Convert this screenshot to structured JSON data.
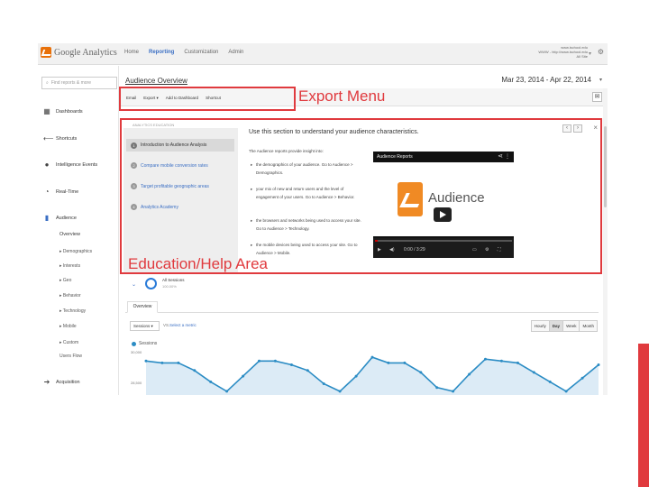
{
  "app": {
    "logo_text": "Google Analytics",
    "top_nav": [
      "Home",
      "Reporting",
      "Customization",
      "Admin"
    ],
    "active_nav": "Reporting",
    "account_line1": "www.ischool.edu",
    "account_line2": "WWW - http://www.ischool.edu",
    "account_line3": "All Site"
  },
  "sidebar": {
    "search_placeholder": "Find reports & more",
    "items": [
      {
        "label": "Dashboards",
        "icon": "grid-icon"
      },
      {
        "label": "Shortcuts",
        "icon": "arrow-left-icon"
      },
      {
        "label": "Intelligence Events",
        "icon": "lightbulb-icon"
      },
      {
        "label": "Real-Time",
        "icon": "clock-icon"
      },
      {
        "label": "Audience",
        "icon": "person-icon"
      },
      {
        "label": "Acquisition",
        "icon": "acquisition-icon"
      }
    ],
    "audience_sub": [
      "Overview",
      "▸ Demographics",
      "▸ Interests",
      "▸ Geo",
      "▸ Behavior",
      "▸ Technology",
      "▸ Mobile",
      "▸ Custom",
      "Users Flow"
    ]
  },
  "header": {
    "page_title": "Audience Overview",
    "date_range": "Mar 23, 2014 - Apr 22, 2014"
  },
  "export_menu": {
    "items": [
      "Email",
      "Export ▾",
      "Add to Dashboard",
      "Shortcut"
    ]
  },
  "help": {
    "section_label": "ANALYTICS EDUCATION",
    "title": "Use this section to understand your audience characteristics.",
    "links": [
      {
        "num": "1",
        "label": "Introduction to Audience Analysis"
      },
      {
        "num": "2",
        "label": "Compare mobile conversion rates"
      },
      {
        "num": "3",
        "label": "Target profitable geographic areas"
      },
      {
        "num": "4",
        "label": "Analytics Academy"
      }
    ],
    "intro": "The Audience reports provide insight into:",
    "bullets": [
      "the demographics of your audience. Go to Audience > Demographics.",
      "your mix of new and return users and the level of engagement of your users. Go to Audience > Behavior.",
      "the browsers and networks being used to access your site. Go to Audience > Technology.",
      "the mobile devices being used to access your site. Go to Audience > Mobile."
    ],
    "video": {
      "title": "Audience Reports",
      "word": "Audience",
      "time": "0:00 / 3:29",
      "progress": 0.02
    }
  },
  "segment": {
    "name": "All Sessions",
    "pct": "100.00%"
  },
  "tabs": {
    "overview": "Overview"
  },
  "metric": {
    "selected": "Sessions ▾",
    "vs": "VS.",
    "select_label": "Select a metric"
  },
  "granularity": {
    "options": [
      "Hourly",
      "Day",
      "Week",
      "Month"
    ],
    "active": "Day"
  },
  "chart_data": {
    "type": "area",
    "series": [
      {
        "name": "Sessions",
        "values": [
          30200,
          30100,
          30100,
          29700,
          29100,
          28600,
          29400,
          30200,
          30200,
          30000,
          29700,
          29000,
          28600,
          29400,
          30400,
          30100,
          30100,
          29600,
          28800,
          28600,
          29500,
          30300,
          30200,
          30100,
          29600,
          29100,
          28600,
          29300,
          30000
        ]
      }
    ],
    "ylim": [
      28500,
      30500
    ],
    "y_ticks": [
      "30,000",
      "28,500"
    ],
    "legend_placement": "top-left",
    "line_color": "#2b8cc4",
    "fill_color": "#dcebf6"
  },
  "annotations": {
    "export_label": "Export Menu",
    "help_label": "Education/Help Area",
    "color": "#e03a3e"
  }
}
